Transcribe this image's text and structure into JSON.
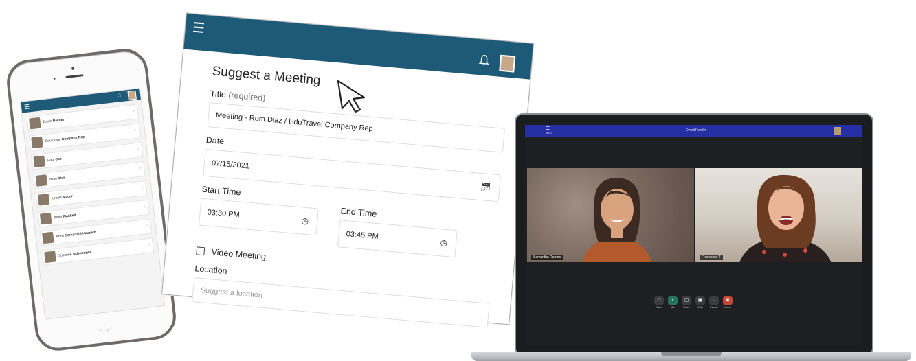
{
  "phone": {
    "menu_icon": "☰",
    "bell_icon": "🔔",
    "contacts": [
      {
        "first": "Dawn",
        "last": "Becker"
      },
      {
        "first": "EduTravel",
        "last": "Company Rep"
      },
      {
        "first": "Paul",
        "last": "Coe"
      },
      {
        "first": "Rom",
        "last": "Diaz"
      },
      {
        "first": "Ursula",
        "last": "Macur"
      },
      {
        "first": "Anita",
        "last": "Plankett"
      },
      {
        "first": "Anne",
        "last": "Sarkadahi-Hauseth"
      },
      {
        "first": "Suzanne",
        "last": "Schwenger"
      }
    ]
  },
  "form": {
    "menu_icon": "☰",
    "title": "Suggest a Meeting",
    "title_label": "Title",
    "title_required": "(required)",
    "title_value": "Meeting - Rom Diaz / EduTravel Company Rep",
    "date_label": "Date",
    "date_value": "07/15/2021",
    "start_label": "Start Time",
    "start_value": "03:30 PM",
    "end_label": "End Time",
    "end_value": "03:45 PM",
    "video_label": "Video Meeting",
    "location_label": "Location",
    "location_placeholder": "Suggest a location"
  },
  "video": {
    "menu_label": "MENU",
    "title": "Event Feed ▾",
    "participants": [
      {
        "name": "Samantha Ramos"
      },
      {
        "name": "Francesca T"
      }
    ],
    "controls": [
      {
        "icon": "camera-icon",
        "label": "Cam"
      },
      {
        "icon": "mic-icon",
        "label": "Mic"
      },
      {
        "icon": "share-icon",
        "label": "Share"
      },
      {
        "icon": "chat-icon",
        "label": "Chat"
      },
      {
        "icon": "people-icon",
        "label": "People"
      },
      {
        "icon": "leave-icon",
        "label": "Leave"
      }
    ],
    "colors": {
      "topbar": "#262ea3",
      "mic": "#26725b",
      "leave": "#c7463a"
    }
  }
}
